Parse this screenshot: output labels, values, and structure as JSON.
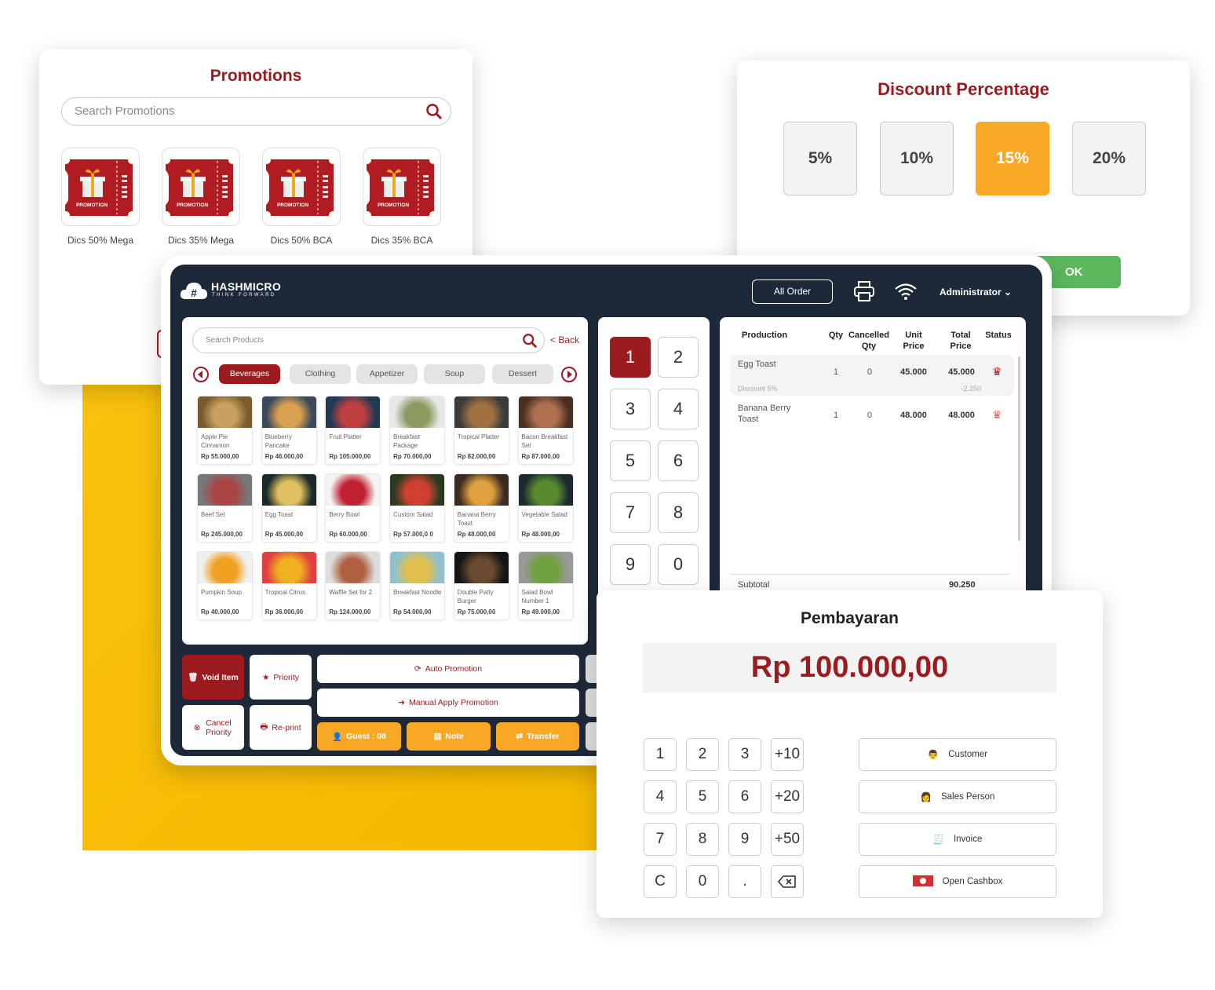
{
  "promotions": {
    "title": "Promotions",
    "search_placeholder": "Search Promotions",
    "ticket_text": "PROMOTION",
    "items": [
      {
        "label": "Dics 50% Mega"
      },
      {
        "label": "Dics 35% Mega"
      },
      {
        "label": "Dics 50% BCA"
      },
      {
        "label": "Dics 35% BCA"
      }
    ]
  },
  "discount": {
    "title": "Discount Percentage",
    "options": [
      "5%",
      "10%",
      "15%",
      "20%"
    ],
    "selected": "15%",
    "ok_label": "OK"
  },
  "header": {
    "brand": "HASHMICRO",
    "tagline": "THINK FORWARD",
    "all_order": "All Order",
    "user": "Administrator"
  },
  "products": {
    "search_placeholder": "Search Products",
    "back": "< Back",
    "categories": [
      "Beverages",
      "Clothing",
      "Appetizer",
      "Soup",
      "Dessert"
    ],
    "selected_category": "Beverages",
    "items": [
      {
        "name": "Apple Pie Cinnamon",
        "price": "Rp 55.000,00"
      },
      {
        "name": "Blueberry Pancake",
        "price": "Rp 46.000,00"
      },
      {
        "name": "Fruit Platter",
        "price": "Rp 105.000,00"
      },
      {
        "name": "Breakfast Package",
        "price": "Rp 70.000,00"
      },
      {
        "name": "Tropical Platter",
        "price": "Rp 82.000,00"
      },
      {
        "name": "Bacon Breakfast Set",
        "price": "Rp 87.000,00"
      },
      {
        "name": "Beef Set",
        "price": "Rp 245.000,00"
      },
      {
        "name": "Egg Toast",
        "price": "Rp 45.000,00"
      },
      {
        "name": "Berry Bowl",
        "price": "Rp 60.000,00"
      },
      {
        "name": "Custom Salad",
        "price": "Rp 57.000,0 0"
      },
      {
        "name": "Banana Berry Toast",
        "price": "Rp 48.000,00"
      },
      {
        "name": "Vegetable Salad",
        "price": "Rp 48.000,00"
      },
      {
        "name": "Pumpkin Soup",
        "price": "Rp 40.000,00"
      },
      {
        "name": "Tropical Citrus",
        "price": "Rp 36.000,00"
      },
      {
        "name": "Waffle Set for 2",
        "price": "Rp 124.000,00"
      },
      {
        "name": "Breakfast Noodle",
        "price": "Rp 54.000,00"
      },
      {
        "name": "Double Patty Burger",
        "price": "Rp 75.000,00"
      },
      {
        "name": "Salad Bowl Number 1",
        "price": "Rp 49.000,00"
      }
    ]
  },
  "numpad": {
    "keys": [
      "1",
      "2",
      "3",
      "4",
      "5",
      "6",
      "7",
      "8",
      "9",
      "0"
    ],
    "selected": "1"
  },
  "order": {
    "columns": [
      "Production",
      "Qty",
      "Cancelled Qty",
      "Unit Price",
      "Total Price",
      "Status"
    ],
    "rows": [
      {
        "name": "Egg Toast",
        "qty": "1",
        "cancelled": "0",
        "unit": "45.000",
        "total": "45.000",
        "discount_label": "Discount 5%",
        "discount_value": "-2.250"
      },
      {
        "name": "Banana Berry Toast",
        "qty": "1",
        "cancelled": "0",
        "unit": "48.000",
        "total": "48.000"
      }
    ],
    "subtotal_label": "Subtotal",
    "subtotal": "90.250"
  },
  "actions": {
    "void": "Void Item",
    "priority": "Priority",
    "cancel_priority": "Cancel Priority",
    "reprint": "Re-print",
    "auto_promo": "Auto Promotion",
    "manual_promo": "Manual Apply Promotion",
    "guest": "Guest : 08",
    "note": "Note",
    "transfer": "Transfer"
  },
  "payment": {
    "title": "Pembayaran",
    "amount": "Rp 100.000,00",
    "keys": [
      "1",
      "2",
      "3",
      "+10",
      "4",
      "5",
      "6",
      "+20",
      "7",
      "8",
      "9",
      "+50",
      "C",
      "0",
      "."
    ],
    "buttons": [
      "Customer",
      "Sales Person",
      "Invoice",
      "Open Cashbox"
    ]
  },
  "colors": {
    "brand_red": "#9b1b1f",
    "accent_orange": "#f9a825",
    "dark": "#1d2939",
    "ok_green": "#5cb85c",
    "yellow_bg": "#f7bd0c"
  }
}
